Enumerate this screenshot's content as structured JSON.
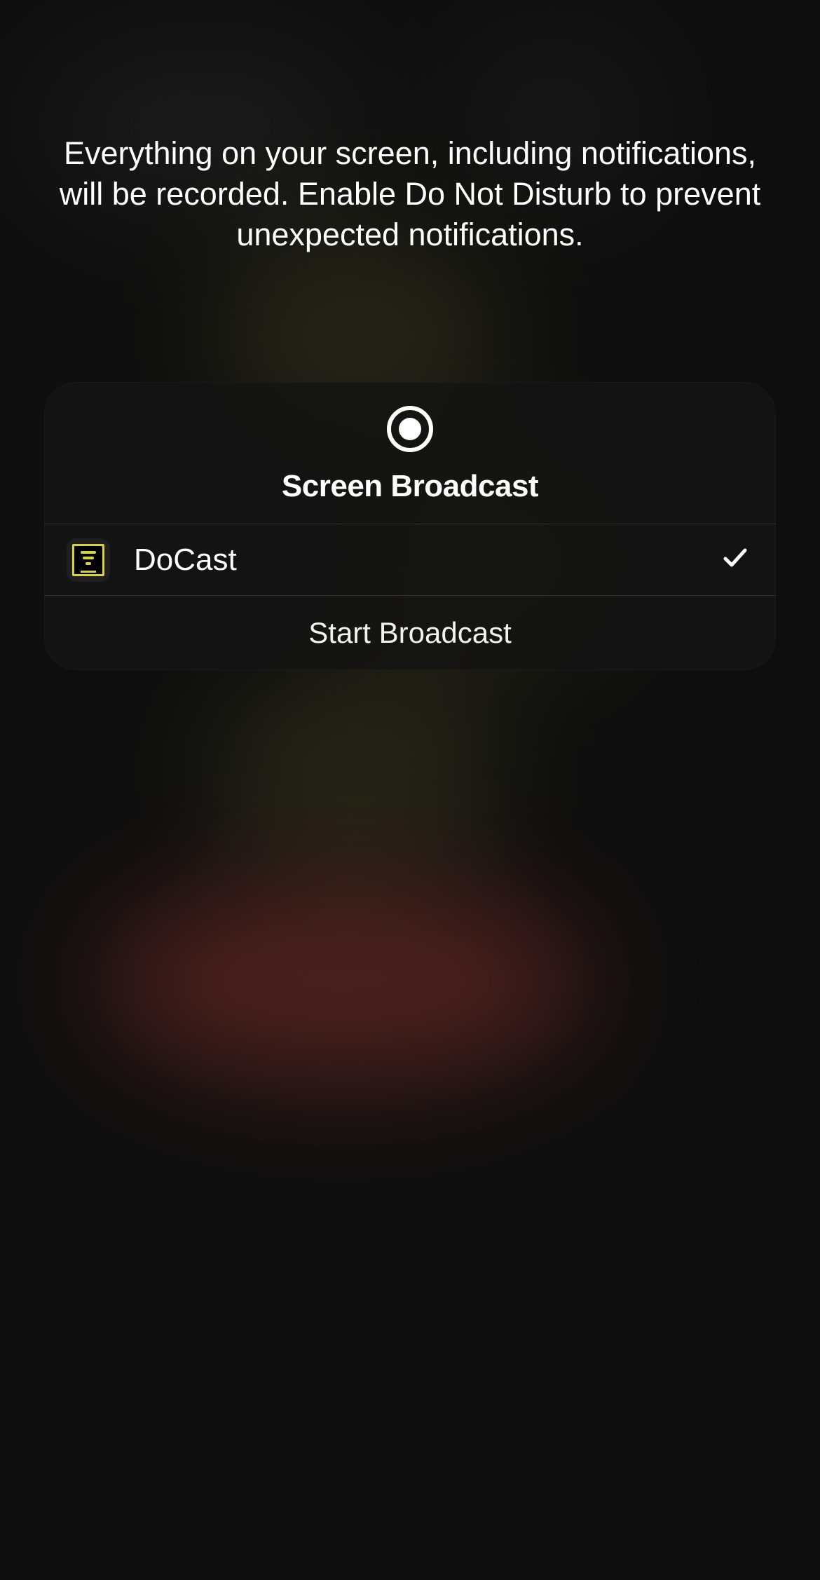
{
  "warning_text": "Everything on your screen, including notifications, will be recorded. Enable Do Not Disturb to prevent unexpected notifications.",
  "sheet": {
    "title": "Screen Broadcast",
    "app": {
      "name": "DoCast",
      "selected": true
    },
    "start_label": "Start Broadcast"
  }
}
